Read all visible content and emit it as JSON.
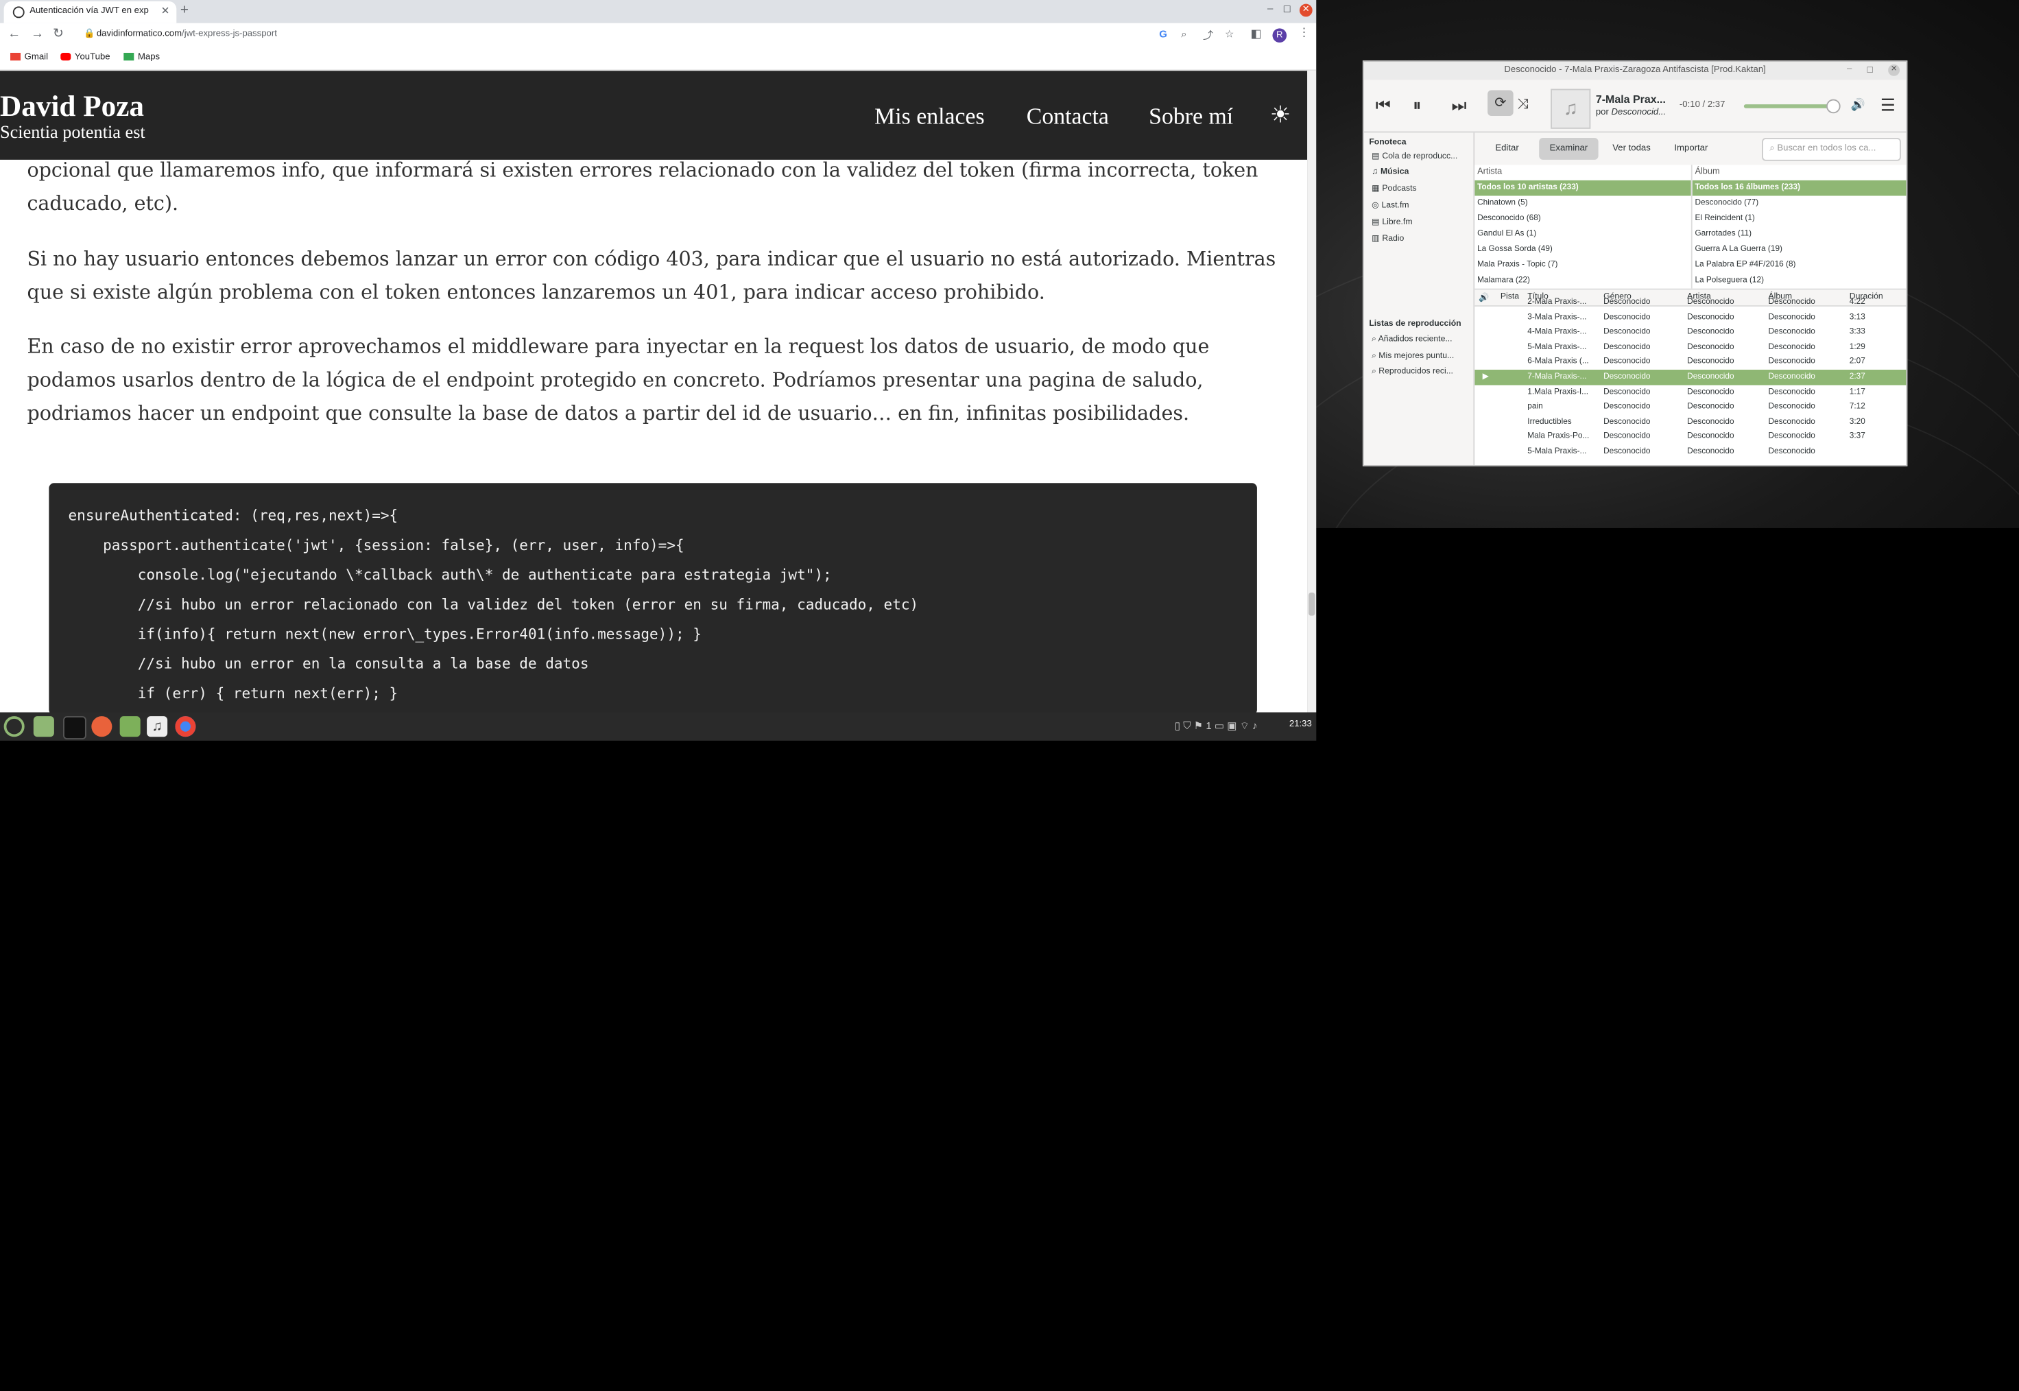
{
  "browser": {
    "tab_title": "Autenticación vía JWT en exp",
    "url_host": "davidinformatico.com",
    "url_path": "/jwt-express-js-passport",
    "profile_initial": "R",
    "bookmarks": [
      "Gmail",
      "YouTube",
      "Maps"
    ]
  },
  "site": {
    "brand": "David Poza",
    "tagline": "Scientia potentia est",
    "nav": [
      "Mis enlaces",
      "Contacta",
      "Sobre mí"
    ]
  },
  "article": {
    "paragraphs": [
      "opcional que llamaremos info, que informará si existen errores relacionado con la validez del token (firma incorrecta, token caducado, etc).",
      "Si no hay usuario entonces debemos lanzar un error con código 403, para indicar que el usuario no está autorizado. Mientras que si existe algún problema con el token entonces lanzaremos un 401, para indicar acceso prohibido.",
      "En caso de no existir error aprovechamos el middleware para inyectar en la request los datos de usuario, de modo que podamos usarlos dentro de la lógica de el endpoint protegido en concreto. Podríamos presentar una pagina de saludo, podriamos hacer un endpoint que consulte la base de datos a partir del id de usuario… en fin, infinitas posibilidades."
    ],
    "code_lines": [
      "ensureAuthenticated: (req,res,next)=>{",
      "    passport.authenticate('jwt', {session: false}, (err, user, info)=>{",
      "        console.log(\"ejecutando \\*callback auth\\* de authenticate para estrategia jwt\");",
      "        //si hubo un error relacionado con la validez del token (error en su firma, caducado, etc)",
      "        if(info){ return next(new error\\_types.Error401(info.message)); }",
      "        //si hubo un error en la consulta a la base de datos",
      "        if (err) { return next(err); }"
    ]
  },
  "player": {
    "window_title": "Desconocido - 7-Mala Praxis-Zaragoza Antifascista [Prod.Kaktan]",
    "now_title": "7-Mala Prax...",
    "now_by_prefix": "por",
    "now_by_artist": "Desconocid...",
    "time": "-0:10 / 2:37",
    "progress_fraction": 0.94,
    "sidebar": {
      "library_header": "Fonoteca",
      "library_items": [
        {
          "label": "Cola de reproducc...",
          "icon": "queue-icon"
        },
        {
          "label": "Música",
          "icon": "music-icon",
          "selected": true
        },
        {
          "label": "Podcasts",
          "icon": "podcast-icon"
        },
        {
          "label": "Last.fm",
          "icon": "lastfm-icon"
        },
        {
          "label": "Libre.fm",
          "icon": "librefm-icon"
        },
        {
          "label": "Radio",
          "icon": "radio-icon"
        }
      ],
      "playlists_header": "Listas de reproducción",
      "playlist_items": [
        "Añadidos reciente...",
        "Mis mejores puntu...",
        "Reproducidos reci..."
      ]
    },
    "browse_tabs": [
      "Editar",
      "Examinar",
      "Ver todas",
      "Importar"
    ],
    "search_placeholder": "Buscar en todos los ca...",
    "artist_header": "Artista",
    "album_header": "Álbum",
    "artists": [
      "Todos los 10 artistas (233)",
      "Chinatown (5)",
      "Desconocido (68)",
      "Gandul El As (1)",
      "La Gossa Sorda (49)",
      "Mala Praxis - Topic (7)",
      "Malamara (22)"
    ],
    "albums": [
      "Todos los 16 álbumes (233)",
      "Desconocido (77)",
      "El Reincident (1)",
      "Garrotades (11)",
      "Guerra A La Guerra (19)",
      "La Palabra EP #4F/2016 (8)",
      "La Polseguera (12)"
    ],
    "track_columns": [
      "Pista",
      "Título",
      "Género",
      "Artista",
      "Álbum",
      "Duración"
    ],
    "tracks": [
      {
        "title": "2-Mala Praxis-...",
        "genre": "Desconocido",
        "artist": "Desconocido",
        "album": "Desconocido",
        "duration": "4:22"
      },
      {
        "title": "3-Mala Praxis-...",
        "genre": "Desconocido",
        "artist": "Desconocido",
        "album": "Desconocido",
        "duration": "3:13"
      },
      {
        "title": "4-Mala Praxis-...",
        "genre": "Desconocido",
        "artist": "Desconocido",
        "album": "Desconocido",
        "duration": "3:33"
      },
      {
        "title": "5-Mala Praxis-...",
        "genre": "Desconocido",
        "artist": "Desconocido",
        "album": "Desconocido",
        "duration": "1:29"
      },
      {
        "title": "6-Mala Praxis (...",
        "genre": "Desconocido",
        "artist": "Desconocido",
        "album": "Desconocido",
        "duration": "2:07"
      },
      {
        "title": "7-Mala Praxis-...",
        "genre": "Desconocido",
        "artist": "Desconocido",
        "album": "Desconocido",
        "duration": "2:37",
        "playing": true
      },
      {
        "title": "1.Mala Praxis-I...",
        "genre": "Desconocido",
        "artist": "Desconocido",
        "album": "Desconocido",
        "duration": "1:17"
      },
      {
        "title": "pain",
        "genre": "Desconocido",
        "artist": "Desconocido",
        "album": "Desconocido",
        "duration": "7:12"
      },
      {
        "title": "Irreductibles",
        "genre": "Desconocido",
        "artist": "Desconocido",
        "album": "Desconocido",
        "duration": "3:20"
      },
      {
        "title": "Mala Praxis-Po...",
        "genre": "Desconocido",
        "artist": "Desconocido",
        "album": "Desconocido",
        "duration": "3:37"
      },
      {
        "title": "5-Mala Praxis-...",
        "genre": "Desconocido",
        "artist": "Desconocido",
        "album": "Desconocido",
        "duration": ""
      }
    ]
  },
  "taskbar": {
    "clock": "21:33",
    "tray_count": "1"
  },
  "colors": {
    "site_header": "#252525",
    "code_bg": "#282828",
    "player_accent": "#8fb774",
    "taskbar": "#2a2a2a"
  }
}
